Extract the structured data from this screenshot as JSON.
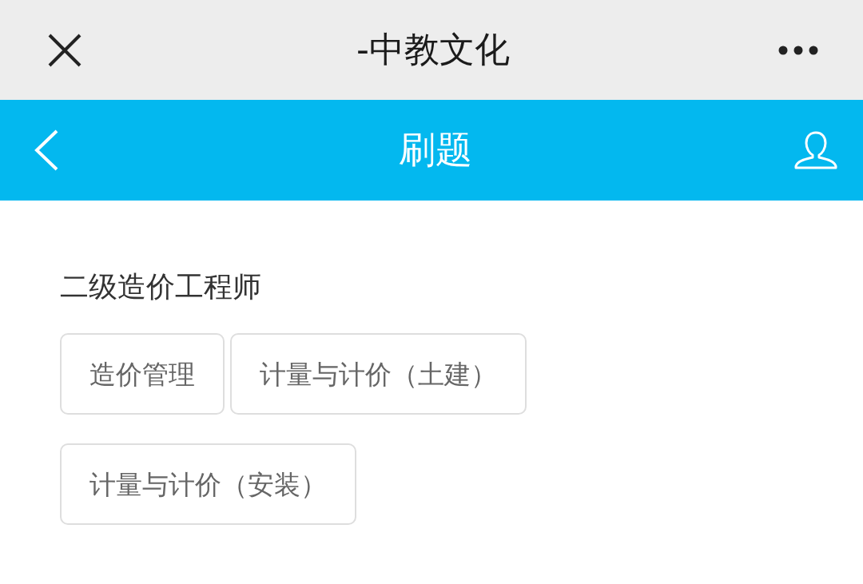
{
  "top_bar": {
    "title": "-中教文化"
  },
  "header": {
    "title": "刷题"
  },
  "section": {
    "title": "二级造价工程师",
    "options": [
      {
        "label": "造价管理"
      },
      {
        "label": "计量与计价（土建）"
      },
      {
        "label": "计量与计价（安装）"
      }
    ]
  }
}
